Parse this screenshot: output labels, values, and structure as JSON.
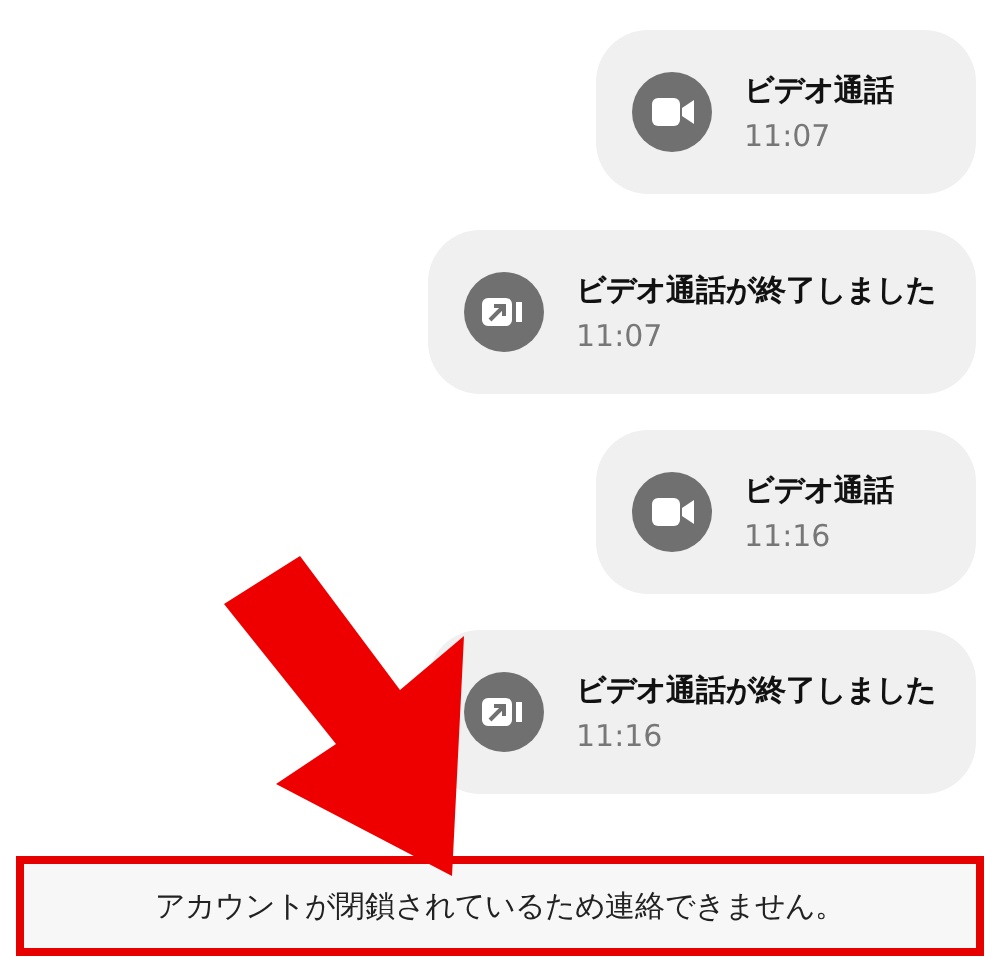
{
  "messages": [
    {
      "kind": "call",
      "title": "ビデオ通話",
      "time": "11:07"
    },
    {
      "kind": "ended",
      "title": "ビデオ通話が終了しました",
      "time": "11:07"
    },
    {
      "kind": "call",
      "title": "ビデオ通話",
      "time": "11:16"
    },
    {
      "kind": "ended",
      "title": "ビデオ通話が終了しました",
      "time": "11:16"
    }
  ],
  "notice": {
    "text": "アカウントが閉鎖されているため連絡できません。"
  }
}
